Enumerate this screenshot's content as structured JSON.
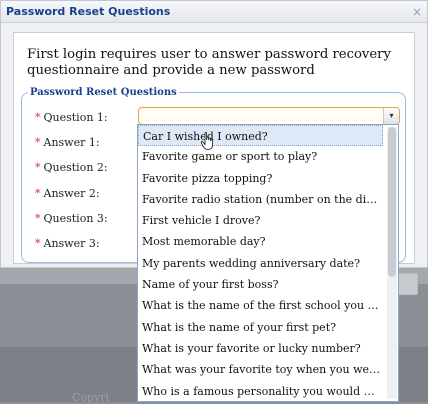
{
  "dialog": {
    "title": "Password Reset Questions",
    "close_label": "×",
    "intro": "First login requires user to answer password recovery questionnaire and provide a new password",
    "fieldset_legend": "Password Reset Questions",
    "required_mark": "*",
    "labels": {
      "q1": "Question 1:",
      "a1": "Answer 1:",
      "q2": "Question 2:",
      "a2": "Answer 2:",
      "q3": "Question 3:",
      "a3": "Answer 3:"
    },
    "question1": {
      "value": "",
      "trigger_glyph": "▾"
    }
  },
  "dropdown": {
    "options": [
      "Car I wished I owned?",
      "Favorite game or sport to play?",
      "Favorite pizza topping?",
      "Favorite radio station (number on the dial - ...",
      "First vehicle I drove?",
      "Most memorable day?",
      "My parents wedding anniversary date?",
      "Name of your first boss?",
      "What is the name of the first school you atten...",
      "What is the name of your first pet?",
      "What is your favorite or lucky number?",
      "What was your favorite toy when you were a...",
      "Who is a famous personality you would most..."
    ]
  },
  "background": {
    "copyright": "Copyri"
  },
  "colors": {
    "accent": "#15428b",
    "required": "#e03030",
    "focus_border": "#e0a54c"
  }
}
